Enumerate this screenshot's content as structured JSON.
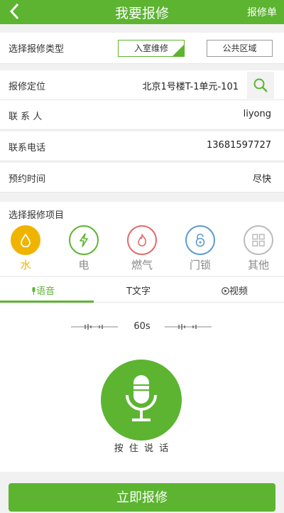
{
  "header": {
    "title": "我要报修",
    "right_link": "报修单"
  },
  "repair_type": {
    "label": "选择报修类型",
    "options": [
      "入室维修",
      "公共区域"
    ],
    "selected": "入室维修"
  },
  "form": {
    "location": {
      "label": "报修定位",
      "value": "北京1号楼T-1单元-101"
    },
    "contact": {
      "label": "联 系 人",
      "value": "liyong"
    },
    "phone": {
      "label": "联系电话",
      "value": "13681597727"
    },
    "appointment": {
      "label": "预约时间",
      "value": "尽快"
    }
  },
  "repair_items": {
    "title": "选择报修项目",
    "items": [
      {
        "name": "水",
        "icon": "water-drop-icon",
        "color": "#f0b400",
        "selected": true
      },
      {
        "name": "电",
        "icon": "lightning-icon",
        "color": "#5cb431",
        "selected": false
      },
      {
        "name": "燃气",
        "icon": "flame-icon",
        "color": "#e36a6a",
        "selected": false
      },
      {
        "name": "门锁",
        "icon": "lock-icon",
        "color": "#5b9bd5",
        "selected": false
      },
      {
        "name": "其他",
        "icon": "grid-icon",
        "color": "#bbbbbb",
        "selected": false
      }
    ]
  },
  "input_tabs": {
    "tabs": [
      {
        "label": "语音",
        "icon": "mic-icon"
      },
      {
        "label": "T文字"
      },
      {
        "label": "视频",
        "icon": "play-icon"
      }
    ],
    "active": "语音"
  },
  "voice": {
    "timer": "60s",
    "hold_label": "按 住 说 话"
  },
  "submit_label": "立即报修",
  "colors": {
    "accent": "#5cb431"
  }
}
